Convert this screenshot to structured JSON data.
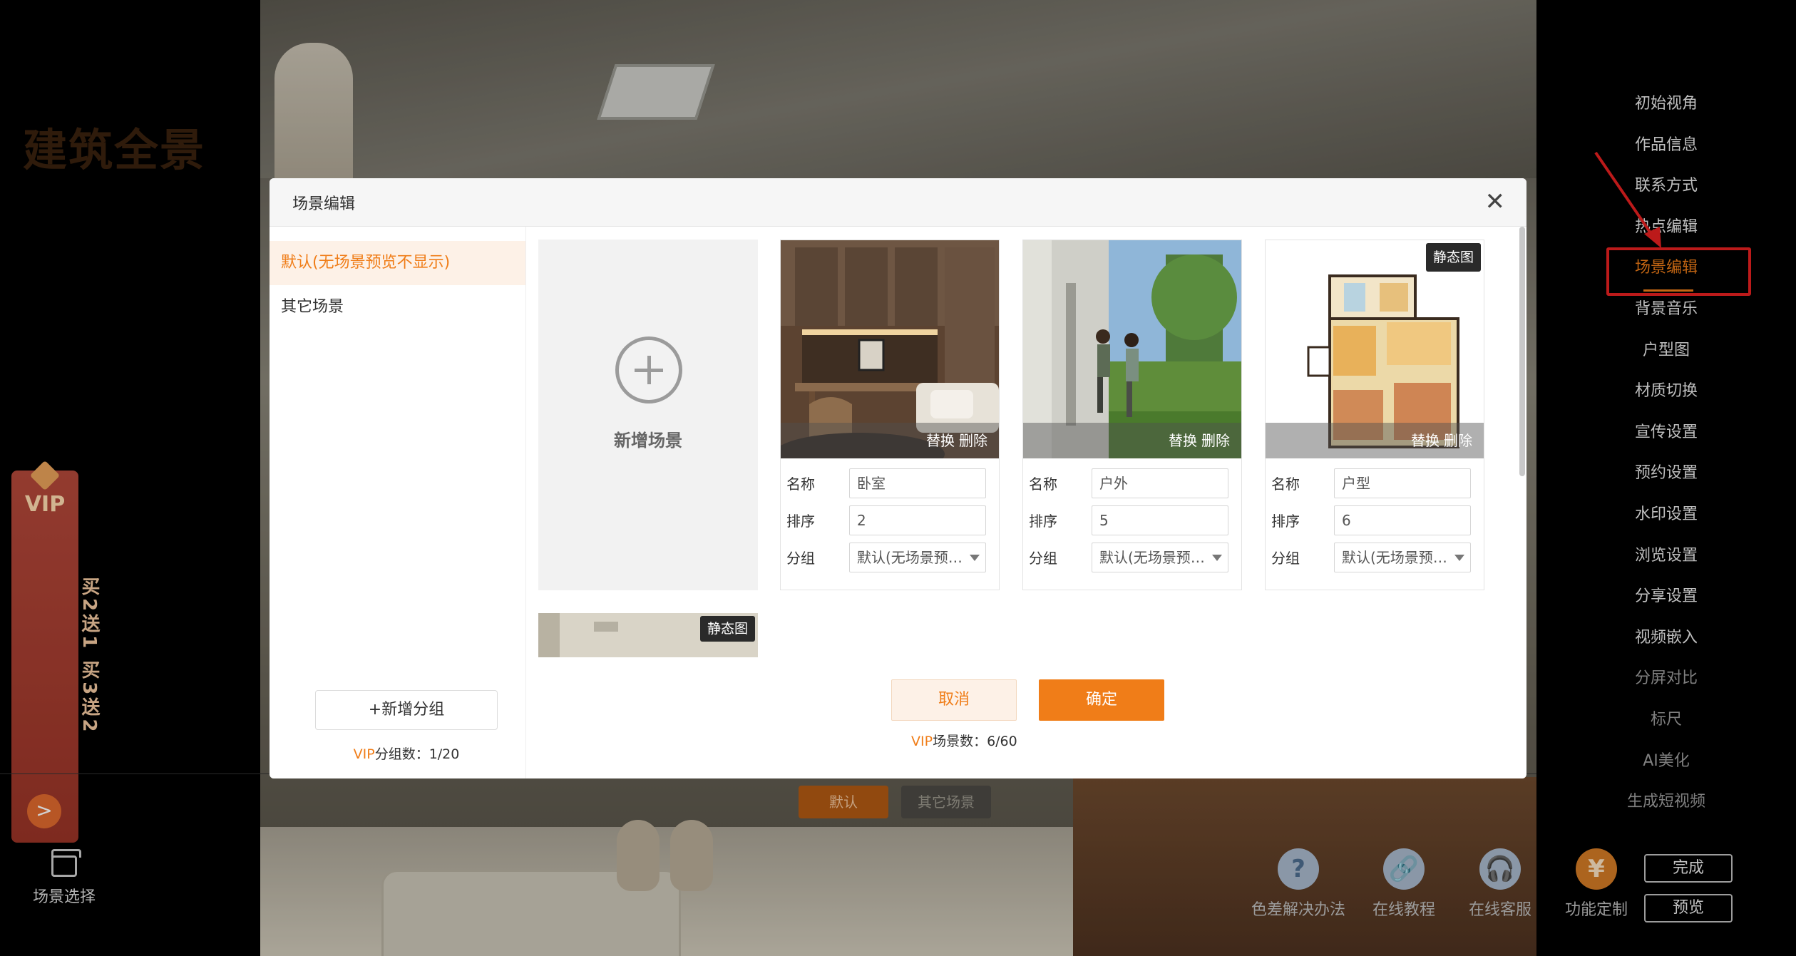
{
  "brand": {
    "logo_text": "建筑全景"
  },
  "vip_banner": {
    "title": "VIP",
    "text": "买2送1 买3送2",
    "go_icon": ">"
  },
  "scene_select": {
    "label": "场景选择",
    "icon": "clapperboard-icon"
  },
  "group_tabs": [
    {
      "label": "默认",
      "active": true
    },
    {
      "label": "其它场景",
      "active": false
    }
  ],
  "right_menu": {
    "items": [
      {
        "label": "初始视角",
        "state": "normal"
      },
      {
        "label": "作品信息",
        "state": "normal"
      },
      {
        "label": "联系方式",
        "state": "normal"
      },
      {
        "label": "热点编辑",
        "state": "normal"
      },
      {
        "label": "场景编辑",
        "state": "active"
      },
      {
        "label": "背景音乐",
        "state": "normal"
      },
      {
        "label": "户型图",
        "state": "normal"
      },
      {
        "label": "材质切换",
        "state": "normal"
      },
      {
        "label": "宣传设置",
        "state": "normal"
      },
      {
        "label": "预约设置",
        "state": "normal"
      },
      {
        "label": "水印设置",
        "state": "normal"
      },
      {
        "label": "浏览设置",
        "state": "normal"
      },
      {
        "label": "分享设置",
        "state": "normal"
      },
      {
        "label": "视频嵌入",
        "state": "normal"
      },
      {
        "label": "分屏对比",
        "state": "dim"
      },
      {
        "label": "标尺",
        "state": "dim"
      },
      {
        "label": "AI美化",
        "state": "dim"
      },
      {
        "label": "生成短视频",
        "state": "dim"
      }
    ],
    "done_label": "完成",
    "preview_label": "预览"
  },
  "bottom_tools": [
    {
      "label": "色差解决办法",
      "icon": "question-icon",
      "glyph": "?"
    },
    {
      "label": "在线教程",
      "icon": "link-icon",
      "glyph": "🔗"
    },
    {
      "label": "在线客服",
      "icon": "headset-icon",
      "glyph": "🎧"
    },
    {
      "label": "功能定制",
      "icon": "yuan-icon",
      "glyph": "¥"
    }
  ],
  "modal": {
    "title": "场景编辑",
    "close_icon": "close-icon",
    "groups": [
      {
        "label": "默认(无场景预览不显示)",
        "active": true
      },
      {
        "label": "其它场景",
        "active": false
      }
    ],
    "add_group_label": "+新增分组",
    "group_count": {
      "vip": "VIP",
      "text": "分组数：1/20"
    },
    "add_scene_label": "新增场景",
    "field_labels": {
      "name": "名称",
      "order": "排序",
      "group": "分组"
    },
    "actions": {
      "replace": "替换",
      "delete": "删除"
    },
    "static_badge": "静态图",
    "scenes": [
      {
        "name": "卧室",
        "order": "2",
        "group": "默认(无场景预览不显示)",
        "static": false
      },
      {
        "name": "户外",
        "order": "5",
        "group": "默认(无场景预览不显示)",
        "static": false
      },
      {
        "name": "户型",
        "order": "6",
        "group": "默认(无场景预览不显示)",
        "static": true
      }
    ],
    "extra_card": {
      "static": true
    },
    "cancel_label": "取消",
    "ok_label": "确定",
    "scene_count": {
      "vip": "VIP",
      "text": "场景数：6/60"
    }
  },
  "colors": {
    "accent": "#f07d18",
    "highlight": "#e62020"
  }
}
